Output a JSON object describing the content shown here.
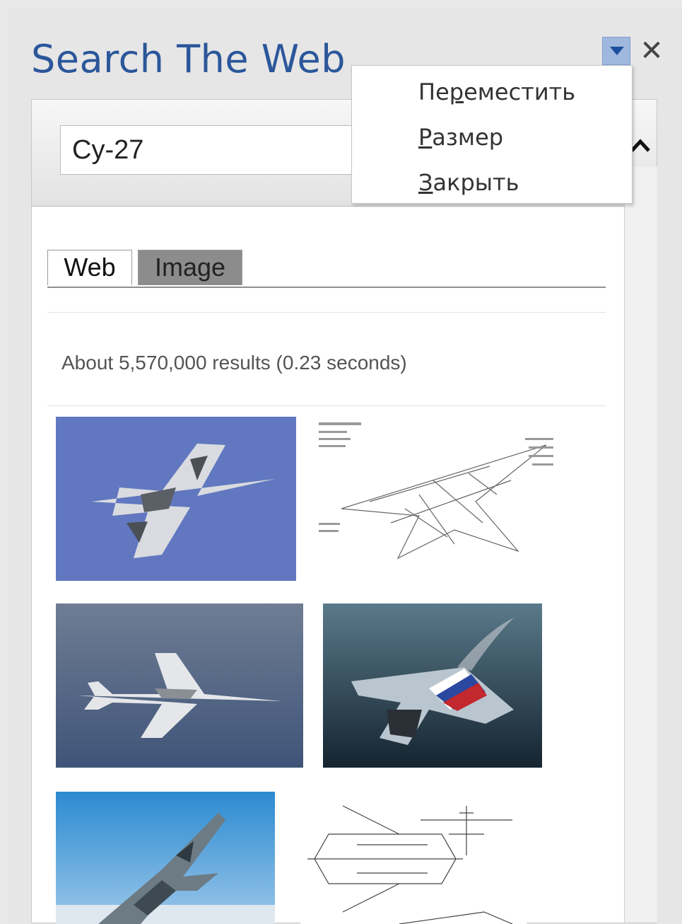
{
  "pane": {
    "title": "Search The Web",
    "icons": {
      "menu": "dropdown-arrow-icon",
      "close": "close-icon",
      "collapse": "chevron-up-icon"
    }
  },
  "search": {
    "query": "Су-27"
  },
  "tabs": [
    {
      "label": "Web",
      "active": false
    },
    {
      "label": "Image",
      "active": true
    }
  ],
  "results": {
    "count_text": "About 5,570,000 results (0.23 seconds)"
  },
  "context_menu": {
    "items": [
      {
        "label": "Переместить",
        "accel_index": 2
      },
      {
        "label": "Размер",
        "accel_index": 0
      },
      {
        "label": "Закрыть",
        "accel_index": 0
      }
    ]
  },
  "images": [
    "photo-jet-blue-sky",
    "cutaway-drawing",
    "photo-jet-grey-sky",
    "illustration-jet-russian-flag",
    "photo-jet-camo-climbing",
    "blueprint-drawing"
  ],
  "colors": {
    "accent": "#2b579a",
    "menu_toggle": "#9fb8dd",
    "active_tab": "#8c8c8c"
  }
}
